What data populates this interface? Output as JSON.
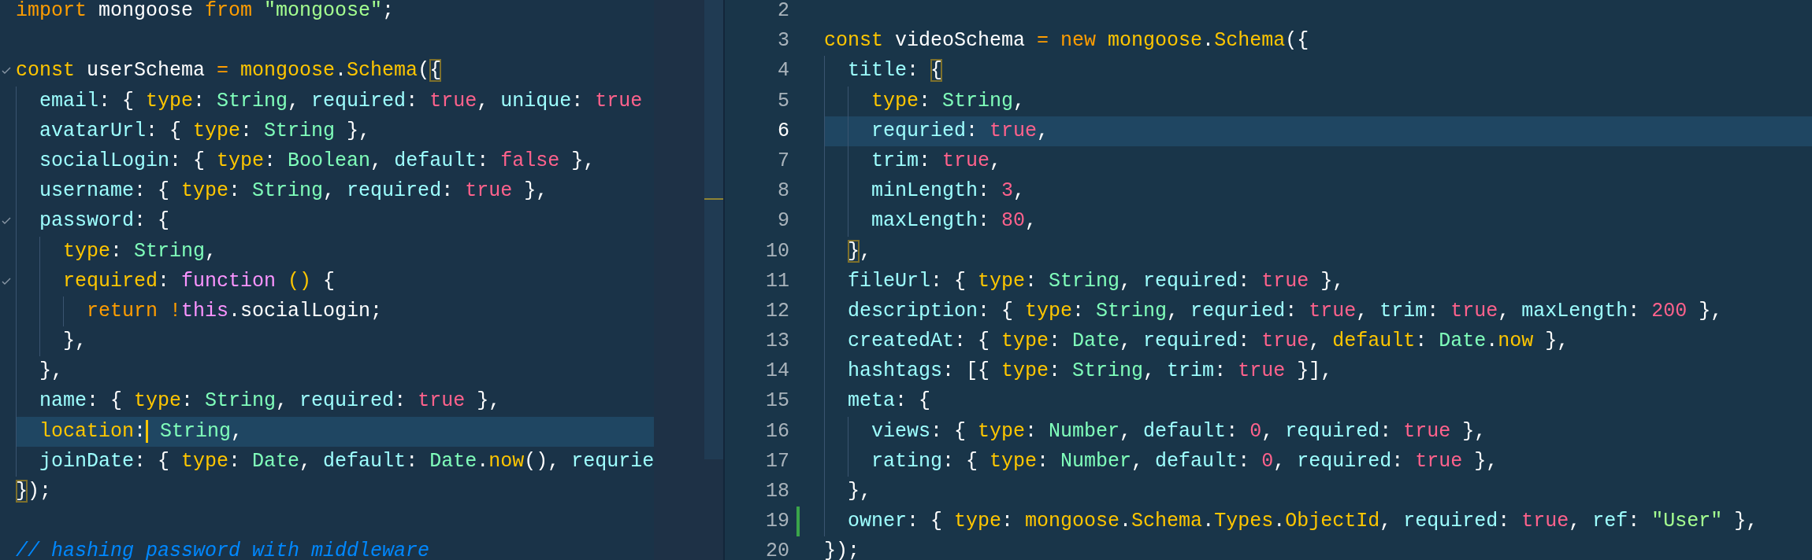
{
  "left_editor": {
    "lines": [
      {
        "tokens": [
          {
            "text": "import",
            "kind": "keyword"
          },
          {
            "text": " mongoose ",
            "kind": "plain"
          },
          {
            "text": "from ",
            "kind": "keyword"
          },
          {
            "text": "\"mongoose\"",
            "kind": "string"
          },
          {
            "text": ";",
            "kind": "plain"
          }
        ]
      },
      {
        "kind": "blank"
      },
      {
        "foldable": true,
        "tokens": [
          {
            "text": "const",
            "kind": "storage"
          },
          {
            "text": " userSchema ",
            "kind": "plain"
          },
          {
            "text": "= ",
            "kind": "keyword"
          },
          {
            "text": "mongoose",
            "kind": "support"
          },
          {
            "text": ".",
            "kind": "plain"
          },
          {
            "text": "Schema",
            "kind": "support"
          },
          {
            "text": "(",
            "kind": "plain"
          },
          {
            "text": "{",
            "kind": "plain",
            "bracket_match": true
          }
        ],
        "children": [
          {
            "tokens": [
              {
                "text": "email",
                "kind": "property"
              },
              {
                "text": ": { ",
                "kind": "plain"
              },
              {
                "text": "type",
                "kind": "support"
              },
              {
                "text": ": ",
                "kind": "plain"
              },
              {
                "text": "String",
                "kind": "class"
              },
              {
                "text": ", ",
                "kind": "plain"
              },
              {
                "text": "required",
                "kind": "property"
              },
              {
                "text": ": ",
                "kind": "plain"
              },
              {
                "text": "true",
                "kind": "constant"
              },
              {
                "text": ", ",
                "kind": "plain"
              },
              {
                "text": "unique",
                "kind": "property"
              },
              {
                "text": ": ",
                "kind": "plain"
              },
              {
                "text": "true",
                "kind": "constant"
              }
            ]
          },
          {
            "tokens": [
              {
                "text": "avatarUrl",
                "kind": "property"
              },
              {
                "text": ": { ",
                "kind": "plain"
              },
              {
                "text": "type",
                "kind": "support"
              },
              {
                "text": ": ",
                "kind": "plain"
              },
              {
                "text": "String",
                "kind": "class"
              },
              {
                "text": " },",
                "kind": "plain"
              }
            ]
          },
          {
            "tokens": [
              {
                "text": "socialLogin",
                "kind": "property"
              },
              {
                "text": ": { ",
                "kind": "plain"
              },
              {
                "text": "type",
                "kind": "support"
              },
              {
                "text": ": ",
                "kind": "plain"
              },
              {
                "text": "Boolean",
                "kind": "class"
              },
              {
                "text": ", ",
                "kind": "plain"
              },
              {
                "text": "default",
                "kind": "property"
              },
              {
                "text": ": ",
                "kind": "plain"
              },
              {
                "text": "false",
                "kind": "constant"
              },
              {
                "text": " },",
                "kind": "plain"
              }
            ]
          },
          {
            "tokens": [
              {
                "text": "username",
                "kind": "property"
              },
              {
                "text": ": { ",
                "kind": "plain"
              },
              {
                "text": "type",
                "kind": "support"
              },
              {
                "text": ": ",
                "kind": "plain"
              },
              {
                "text": "String",
                "kind": "class"
              },
              {
                "text": ", ",
                "kind": "plain"
              },
              {
                "text": "required",
                "kind": "property"
              },
              {
                "text": ": ",
                "kind": "plain"
              },
              {
                "text": "true",
                "kind": "constant"
              },
              {
                "text": " },",
                "kind": "plain"
              }
            ]
          },
          {
            "foldable": true,
            "tokens": [
              {
                "text": "password",
                "kind": "property"
              },
              {
                "text": ": {",
                "kind": "plain"
              }
            ],
            "children": [
              {
                "tokens": [
                  {
                    "text": "type",
                    "kind": "support"
                  },
                  {
                    "text": ": ",
                    "kind": "plain"
                  },
                  {
                    "text": "String",
                    "kind": "class"
                  },
                  {
                    "text": ",",
                    "kind": "plain"
                  }
                ]
              },
              {
                "foldable": true,
                "tokens": [
                  {
                    "text": "required",
                    "kind": "support"
                  },
                  {
                    "text": ": ",
                    "kind": "plain"
                  },
                  {
                    "text": "function ",
                    "kind": "function"
                  },
                  {
                    "text": "()",
                    "kind": "support"
                  },
                  {
                    "text": " {",
                    "kind": "plain"
                  }
                ],
                "children": [
                  {
                    "tokens": [
                      {
                        "text": "return !",
                        "kind": "keyword"
                      },
                      {
                        "text": "this",
                        "kind": "function"
                      },
                      {
                        "text": ".socialLogin;",
                        "kind": "plain"
                      }
                    ]
                  }
                ]
              },
              {
                "tokens": [
                  {
                    "text": "},",
                    "kind": "plain"
                  }
                ]
              }
            ]
          },
          {
            "tokens": [
              {
                "text": "},",
                "kind": "plain"
              }
            ]
          },
          {
            "tokens": [
              {
                "text": "name",
                "kind": "property"
              },
              {
                "text": ": { ",
                "kind": "plain"
              },
              {
                "text": "type",
                "kind": "support"
              },
              {
                "text": ": ",
                "kind": "plain"
              },
              {
                "text": "String",
                "kind": "class"
              },
              {
                "text": ", ",
                "kind": "plain"
              },
              {
                "text": "required",
                "kind": "property"
              },
              {
                "text": ": ",
                "kind": "plain"
              },
              {
                "text": "true",
                "kind": "constant"
              },
              {
                "text": " },",
                "kind": "plain"
              }
            ]
          },
          {
            "current": true,
            "tokens": [
              {
                "text": "location",
                "kind": "support"
              },
              {
                "text": ":",
                "kind": "plain",
                "cursor_after": true
              },
              {
                "text": " String",
                "kind": "class"
              },
              {
                "text": ",",
                "kind": "plain"
              }
            ]
          },
          {
            "tokens": [
              {
                "text": "joinDate",
                "kind": "property"
              },
              {
                "text": ": { ",
                "kind": "plain"
              },
              {
                "text": "type",
                "kind": "support"
              },
              {
                "text": ": ",
                "kind": "plain"
              },
              {
                "text": "Date",
                "kind": "class"
              },
              {
                "text": ", ",
                "kind": "plain"
              },
              {
                "text": "default",
                "kind": "property"
              },
              {
                "text": ": ",
                "kind": "plain"
              },
              {
                "text": "Date",
                "kind": "class"
              },
              {
                "text": ".",
                "kind": "plain"
              },
              {
                "text": "now",
                "kind": "support"
              },
              {
                "text": "(), ",
                "kind": "plain"
              },
              {
                "text": "requrie",
                "kind": "property"
              }
            ]
          }
        ]
      },
      {
        "tokens": [
          {
            "text": "}",
            "kind": "plain",
            "bracket_match": true
          },
          {
            "text": ");",
            "kind": "plain"
          }
        ]
      },
      {
        "kind": "blank"
      },
      {
        "tokens": [
          {
            "text": "// hashing password with middleware",
            "kind": "comment"
          }
        ]
      }
    ]
  },
  "right_editor": {
    "lines": [
      {
        "number": "2"
      },
      {
        "number": "3",
        "tokens": [
          {
            "text": "const",
            "kind": "storage"
          },
          {
            "text": " videoSchema ",
            "kind": "plain"
          },
          {
            "text": "= new ",
            "kind": "keyword"
          },
          {
            "text": "mongoose",
            "kind": "support"
          },
          {
            "text": ".",
            "kind": "plain"
          },
          {
            "text": "Schema",
            "kind": "support"
          },
          {
            "text": "({",
            "kind": "plain"
          }
        ],
        "children": [
          {
            "number": "4",
            "tokens": [
              {
                "text": "title",
                "kind": "property"
              },
              {
                "text": ": ",
                "kind": "plain"
              },
              {
                "text": "{",
                "kind": "plain",
                "bracket_match": true
              }
            ],
            "children": [
              {
                "number": "5",
                "tokens": [
                  {
                    "text": "type",
                    "kind": "support"
                  },
                  {
                    "text": ": ",
                    "kind": "plain"
                  },
                  {
                    "text": "String",
                    "kind": "class"
                  },
                  {
                    "text": ",",
                    "kind": "plain"
                  }
                ]
              },
              {
                "number": "6",
                "current": true,
                "tokens": [
                  {
                    "text": "requried",
                    "kind": "property"
                  },
                  {
                    "text": ": ",
                    "kind": "plain"
                  },
                  {
                    "text": "true",
                    "kind": "constant"
                  },
                  {
                    "text": ",",
                    "kind": "plain"
                  }
                ]
              },
              {
                "number": "7",
                "tokens": [
                  {
                    "text": "trim",
                    "kind": "property"
                  },
                  {
                    "text": ": ",
                    "kind": "plain"
                  },
                  {
                    "text": "true",
                    "kind": "constant"
                  },
                  {
                    "text": ",",
                    "kind": "plain"
                  }
                ]
              },
              {
                "number": "8",
                "tokens": [
                  {
                    "text": "minLength",
                    "kind": "property"
                  },
                  {
                    "text": ": ",
                    "kind": "plain"
                  },
                  {
                    "text": "3",
                    "kind": "constant"
                  },
                  {
                    "text": ",",
                    "kind": "plain"
                  }
                ]
              },
              {
                "number": "9",
                "tokens": [
                  {
                    "text": "maxLength",
                    "kind": "property"
                  },
                  {
                    "text": ": ",
                    "kind": "plain"
                  },
                  {
                    "text": "80",
                    "kind": "constant"
                  },
                  {
                    "text": ",",
                    "kind": "plain"
                  }
                ]
              }
            ]
          },
          {
            "number": "10",
            "tokens": [
              {
                "text": "}",
                "kind": "plain",
                "bracket_match": true
              },
              {
                "text": ",",
                "kind": "plain"
              }
            ]
          },
          {
            "number": "11",
            "tokens": [
              {
                "text": "fileUrl",
                "kind": "property"
              },
              {
                "text": ": { ",
                "kind": "plain"
              },
              {
                "text": "type",
                "kind": "support"
              },
              {
                "text": ": ",
                "kind": "plain"
              },
              {
                "text": "String",
                "kind": "class"
              },
              {
                "text": ", ",
                "kind": "plain"
              },
              {
                "text": "required",
                "kind": "property"
              },
              {
                "text": ": ",
                "kind": "plain"
              },
              {
                "text": "true",
                "kind": "constant"
              },
              {
                "text": " },",
                "kind": "plain"
              }
            ]
          },
          {
            "number": "12",
            "tokens": [
              {
                "text": "description",
                "kind": "property"
              },
              {
                "text": ": { ",
                "kind": "plain"
              },
              {
                "text": "type",
                "kind": "support"
              },
              {
                "text": ": ",
                "kind": "plain"
              },
              {
                "text": "String",
                "kind": "class"
              },
              {
                "text": ", ",
                "kind": "plain"
              },
              {
                "text": "requried",
                "kind": "property"
              },
              {
                "text": ": ",
                "kind": "plain"
              },
              {
                "text": "true",
                "kind": "constant"
              },
              {
                "text": ", ",
                "kind": "plain"
              },
              {
                "text": "trim",
                "kind": "property"
              },
              {
                "text": ": ",
                "kind": "plain"
              },
              {
                "text": "true",
                "kind": "constant"
              },
              {
                "text": ", ",
                "kind": "plain"
              },
              {
                "text": "maxLength",
                "kind": "property"
              },
              {
                "text": ": ",
                "kind": "plain"
              },
              {
                "text": "200",
                "kind": "constant"
              },
              {
                "text": " },",
                "kind": "plain"
              }
            ]
          },
          {
            "number": "13",
            "tokens": [
              {
                "text": "createdAt",
                "kind": "property"
              },
              {
                "text": ": { ",
                "kind": "plain"
              },
              {
                "text": "type",
                "kind": "support"
              },
              {
                "text": ": ",
                "kind": "plain"
              },
              {
                "text": "Date",
                "kind": "class"
              },
              {
                "text": ", ",
                "kind": "plain"
              },
              {
                "text": "required",
                "kind": "property"
              },
              {
                "text": ": ",
                "kind": "plain"
              },
              {
                "text": "true",
                "kind": "constant"
              },
              {
                "text": ", ",
                "kind": "plain"
              },
              {
                "text": "default",
                "kind": "support"
              },
              {
                "text": ": ",
                "kind": "plain"
              },
              {
                "text": "Date",
                "kind": "class"
              },
              {
                "text": ".",
                "kind": "plain"
              },
              {
                "text": "now",
                "kind": "support"
              },
              {
                "text": " },",
                "kind": "plain"
              }
            ]
          },
          {
            "number": "14",
            "tokens": [
              {
                "text": "hashtags",
                "kind": "property"
              },
              {
                "text": ": [{ ",
                "kind": "plain"
              },
              {
                "text": "type",
                "kind": "support"
              },
              {
                "text": ": ",
                "kind": "plain"
              },
              {
                "text": "String",
                "kind": "class"
              },
              {
                "text": ", ",
                "kind": "plain"
              },
              {
                "text": "trim",
                "kind": "property"
              },
              {
                "text": ": ",
                "kind": "plain"
              },
              {
                "text": "true",
                "kind": "constant"
              },
              {
                "text": " }],",
                "kind": "plain"
              }
            ]
          },
          {
            "number": "15",
            "tokens": [
              {
                "text": "meta",
                "kind": "property"
              },
              {
                "text": ": {",
                "kind": "plain"
              }
            ],
            "children": [
              {
                "number": "16",
                "tokens": [
                  {
                    "text": "views",
                    "kind": "property"
                  },
                  {
                    "text": ": { ",
                    "kind": "plain"
                  },
                  {
                    "text": "type",
                    "kind": "support"
                  },
                  {
                    "text": ": ",
                    "kind": "plain"
                  },
                  {
                    "text": "Number",
                    "kind": "class"
                  },
                  {
                    "text": ", ",
                    "kind": "plain"
                  },
                  {
                    "text": "default",
                    "kind": "property"
                  },
                  {
                    "text": ": ",
                    "kind": "plain"
                  },
                  {
                    "text": "0",
                    "kind": "constant"
                  },
                  {
                    "text": ", ",
                    "kind": "plain"
                  },
                  {
                    "text": "required",
                    "kind": "property"
                  },
                  {
                    "text": ": ",
                    "kind": "plain"
                  },
                  {
                    "text": "true",
                    "kind": "constant"
                  },
                  {
                    "text": " },",
                    "kind": "plain"
                  }
                ]
              },
              {
                "number": "17",
                "tokens": [
                  {
                    "text": "rating",
                    "kind": "property"
                  },
                  {
                    "text": ": { ",
                    "kind": "plain"
                  },
                  {
                    "text": "type",
                    "kind": "support"
                  },
                  {
                    "text": ": ",
                    "kind": "plain"
                  },
                  {
                    "text": "Number",
                    "kind": "class"
                  },
                  {
                    "text": ", ",
                    "kind": "plain"
                  },
                  {
                    "text": "default",
                    "kind": "property"
                  },
                  {
                    "text": ": ",
                    "kind": "plain"
                  },
                  {
                    "text": "0",
                    "kind": "constant"
                  },
                  {
                    "text": ", ",
                    "kind": "plain"
                  },
                  {
                    "text": "required",
                    "kind": "property"
                  },
                  {
                    "text": ": ",
                    "kind": "plain"
                  },
                  {
                    "text": "true",
                    "kind": "constant"
                  },
                  {
                    "text": " },",
                    "kind": "plain"
                  }
                ]
              }
            ]
          },
          {
            "number": "18",
            "tokens": [
              {
                "text": "},",
                "kind": "plain"
              }
            ]
          },
          {
            "number": "19",
            "modified": true,
            "tokens": [
              {
                "text": "owner",
                "kind": "property"
              },
              {
                "text": ": { ",
                "kind": "plain"
              },
              {
                "text": "type",
                "kind": "support"
              },
              {
                "text": ": ",
                "kind": "plain"
              },
              {
                "text": "mongoose",
                "kind": "support"
              },
              {
                "text": ".",
                "kind": "plain"
              },
              {
                "text": "Schema",
                "kind": "support"
              },
              {
                "text": ".",
                "kind": "plain"
              },
              {
                "text": "Types",
                "kind": "support"
              },
              {
                "text": ".",
                "kind": "plain"
              },
              {
                "text": "ObjectId",
                "kind": "support"
              },
              {
                "text": ", ",
                "kind": "plain"
              },
              {
                "text": "required",
                "kind": "property"
              },
              {
                "text": ": ",
                "kind": "plain"
              },
              {
                "text": "true",
                "kind": "constant"
              },
              {
                "text": ", ",
                "kind": "plain"
              },
              {
                "text": "ref",
                "kind": "property"
              },
              {
                "text": ": ",
                "kind": "plain"
              },
              {
                "text": "\"User\"",
                "kind": "string"
              },
              {
                "text": " },",
                "kind": "plain"
              }
            ]
          }
        ]
      },
      {
        "number": "20",
        "tokens": [
          {
            "text": "});",
            "kind": "plain"
          }
        ]
      }
    ]
  }
}
